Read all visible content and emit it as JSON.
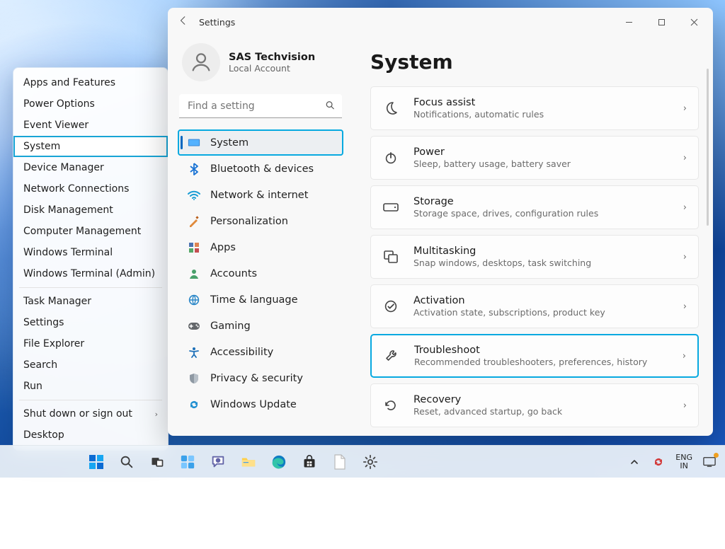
{
  "context_menu": {
    "items": [
      "Apps and Features",
      "Power Options",
      "Event Viewer",
      "System",
      "Device Manager",
      "Network Connections",
      "Disk Management",
      "Computer Management",
      "Windows Terminal",
      "Windows Terminal (Admin)",
      "Task Manager",
      "Settings",
      "File Explorer",
      "Search",
      "Run",
      "Shut down or sign out",
      "Desktop"
    ],
    "selected_index": 3,
    "separators_after": [
      9,
      14
    ]
  },
  "settings": {
    "app_title": "Settings",
    "account": {
      "name": "SAS Techvision",
      "sub": "Local Account"
    },
    "search_placeholder": "Find a setting",
    "nav": [
      {
        "label": "System",
        "icon": "display"
      },
      {
        "label": "Bluetooth & devices",
        "icon": "bluetooth"
      },
      {
        "label": "Network & internet",
        "icon": "wifi"
      },
      {
        "label": "Personalization",
        "icon": "paint"
      },
      {
        "label": "Apps",
        "icon": "apps"
      },
      {
        "label": "Accounts",
        "icon": "person"
      },
      {
        "label": "Time & language",
        "icon": "globe"
      },
      {
        "label": "Gaming",
        "icon": "gamepad"
      },
      {
        "label": "Accessibility",
        "icon": "accessibility"
      },
      {
        "label": "Privacy & security",
        "icon": "shield"
      },
      {
        "label": "Windows Update",
        "icon": "update"
      }
    ],
    "nav_selected_index": 0,
    "main_title": "System",
    "cards": [
      {
        "title": "Focus assist",
        "sub": "Notifications, automatic rules",
        "icon": "moon"
      },
      {
        "title": "Power",
        "sub": "Sleep, battery usage, battery saver",
        "icon": "power"
      },
      {
        "title": "Storage",
        "sub": "Storage space, drives, configuration rules",
        "icon": "drive"
      },
      {
        "title": "Multitasking",
        "sub": "Snap windows, desktops, task switching",
        "icon": "windows"
      },
      {
        "title": "Activation",
        "sub": "Activation state, subscriptions, product key",
        "icon": "check"
      },
      {
        "title": "Troubleshoot",
        "sub": "Recommended troubleshooters, preferences, history",
        "icon": "wrench",
        "highlight": true
      },
      {
        "title": "Recovery",
        "sub": "Reset, advanced startup, go back",
        "icon": "recovery"
      }
    ]
  },
  "taskbar": {
    "tray": {
      "lang1": "ENG",
      "lang2": "IN"
    }
  }
}
